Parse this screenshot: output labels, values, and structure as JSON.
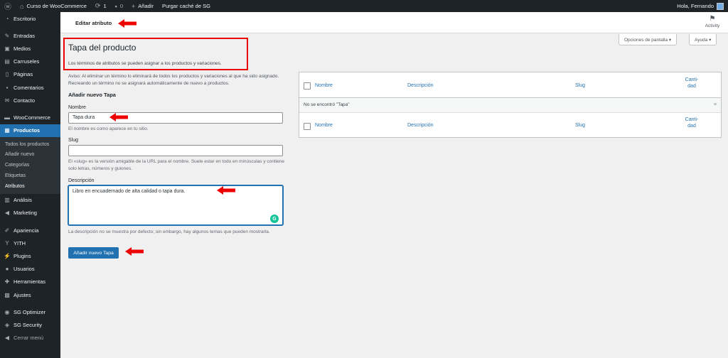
{
  "adminbar": {
    "site_name": "Curso de WooCommerce",
    "updates_count": "1",
    "comments_count": "0",
    "add_new": "Añadir",
    "purge_cache": "Purgar caché de SG",
    "greeting": "Hola, Fernando"
  },
  "sidebar": {
    "items": [
      {
        "label": "Escritorio",
        "icon": "dashboard-icon"
      },
      {
        "label": "Entradas",
        "icon": "pin-icon"
      },
      {
        "label": "Medios",
        "icon": "media-icon"
      },
      {
        "label": "Carruseles",
        "icon": "carousel-icon"
      },
      {
        "label": "Páginas",
        "icon": "page-icon"
      },
      {
        "label": "Comentarios",
        "icon": "comment-icon"
      },
      {
        "label": "Contacto",
        "icon": "mail-icon"
      },
      {
        "label": "WooCommerce",
        "icon": "woo-icon"
      },
      {
        "label": "Productos",
        "icon": "archive-icon"
      },
      {
        "label": "Análisis",
        "icon": "chart-icon"
      },
      {
        "label": "Marketing",
        "icon": "megaphone-icon"
      },
      {
        "label": "Apariencia",
        "icon": "brush-icon"
      },
      {
        "label": "YITH",
        "icon": "yith-icon"
      },
      {
        "label": "Plugins",
        "icon": "plugin-icon"
      },
      {
        "label": "Usuarios",
        "icon": "user-icon"
      },
      {
        "label": "Herramientas",
        "icon": "wrench-icon"
      },
      {
        "label": "Ajustes",
        "icon": "settings-icon"
      },
      {
        "label": "SG Optimizer",
        "icon": "sg-icon"
      },
      {
        "label": "SG Security",
        "icon": "shield-icon"
      },
      {
        "label": "Cerrar menú",
        "icon": "collapse-icon"
      }
    ],
    "submenu": [
      "Todos los productos",
      "Añadir nuevo",
      "Categorías",
      "Etiquetas",
      "Atributos"
    ]
  },
  "header": {
    "title": "Editar atributo",
    "activity": "Activity"
  },
  "screen_options": {
    "options_label": "Opciones de pantalla ▾",
    "help_label": "Ayuda ▾"
  },
  "page": {
    "title": "Tapa del producto",
    "intro": "Los términos de atributos se pueden asignar a los productos y variaciones.",
    "notice": "Aviso: Al eliminar un término lo eliminará de todos los productos y variaciones al que ha sido asignado. Recreando un término no se asignará automáticamente de nuevo a productos.",
    "add_heading": "Añadir nuevo Tapa"
  },
  "form": {
    "name_label": "Nombre",
    "name_value": "Tapa dura",
    "name_help": "El nombre es como aparece en tu sitio.",
    "slug_label": "Slug",
    "slug_value": "",
    "slug_help": "El «slug» es la versión amigable de la URL para el nombre. Suele estar en todo en minúsculas y contiene solo letras, números y guiones.",
    "desc_label": "Descripción",
    "desc_value": "Libro en encuadernado de alta calidad o tapa dura.",
    "desc_help": "La descripción no se muestra por defecto; sin embargo, hay algunos temas que pueden mostrarla.",
    "submit_label": "Añadir nuevo Tapa"
  },
  "table": {
    "col_name": "Nombre",
    "col_desc": "Descripción",
    "col_slug": "Slug",
    "col_count_1": "Canti-",
    "col_count_2": "dad",
    "empty": "No se encontró \"Tapa\""
  },
  "colors": {
    "admin_dark": "#1d2327",
    "accent": "#2271b1",
    "annotation": "#e00000"
  }
}
